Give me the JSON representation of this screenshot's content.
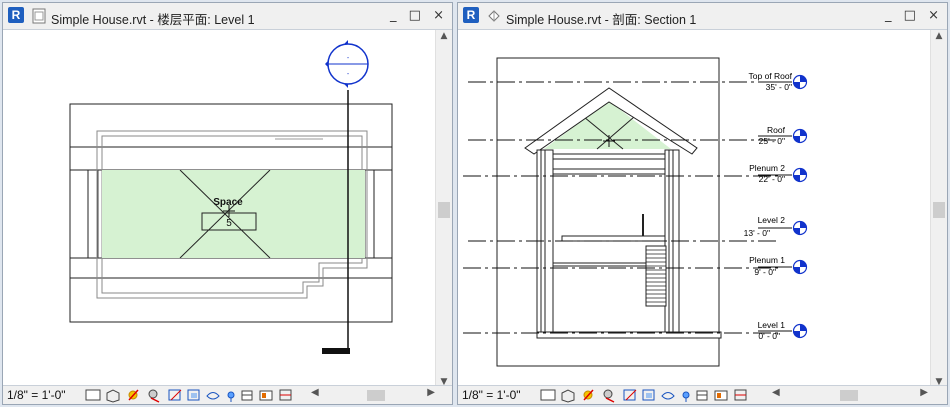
{
  "windows": [
    {
      "title": "Simple House.rvt - 楼层平面: Level 1",
      "scale": "1/8\" = 1'-0\"",
      "space": {
        "name": "Space",
        "number": "5"
      }
    },
    {
      "title": "Simple House.rvt - 剖面: Section 1",
      "scale": "1/8\" = 1'-0\"",
      "levels": [
        {
          "name": "Top of Roof",
          "elev": "35' - 0\""
        },
        {
          "name": "Roof",
          "elev": "25' - 0\""
        },
        {
          "name": "Plenum 2",
          "elev": "22' - 0\""
        },
        {
          "name": "Level 2",
          "elev": "13' - 0\""
        },
        {
          "name": "Plenum 1",
          "elev": "9' - 0\""
        },
        {
          "name": "Level 1",
          "elev": "0' - 0\""
        }
      ]
    }
  ],
  "app_logo": "R",
  "window_controls": "_ □ ×",
  "icons": [
    "detail-level-icon",
    "visual-style-icon",
    "sun-path-icon",
    "shadows-icon",
    "crop-view-icon",
    "show-crop-icon",
    "temporary-hide-icon",
    "reveal-hidden-icon",
    "analytical-model-icon",
    "highlight-displacement-icon",
    "reveal-constraints-icon"
  ]
}
